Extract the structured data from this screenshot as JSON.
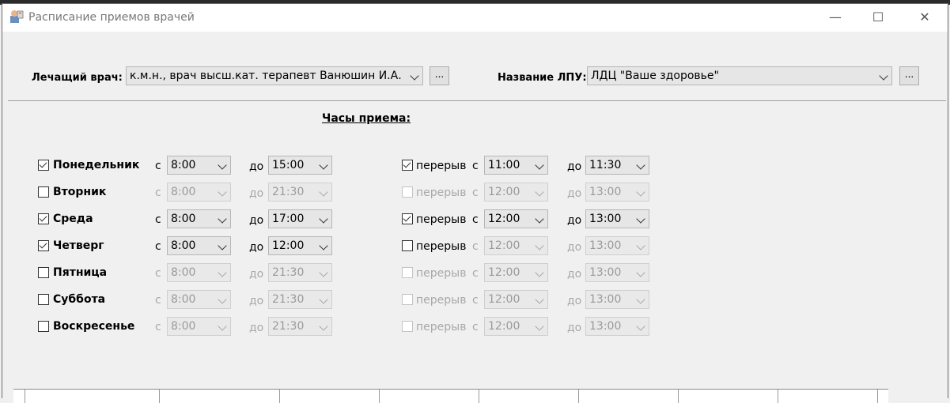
{
  "window": {
    "title": "Расписание приемов врачей",
    "min_icon": "minimize-icon",
    "max_icon": "maximize-icon",
    "close_icon": "close-icon"
  },
  "doctor": {
    "label": "Лечащий врач:",
    "value": "к.м.н., врач высш.кат. терапевт Ванюшин И.А.",
    "button": "..."
  },
  "lpu": {
    "label": "Название ЛПУ:",
    "value": "ЛДЦ \"Ваше здоровье\"",
    "button": "..."
  },
  "hours_title": "Часы приема:",
  "labels": {
    "from": "с",
    "to": "до",
    "break": "перерыв"
  },
  "days": [
    {
      "name": "Понедельник",
      "checked": true,
      "from": "8:00",
      "to": "15:00",
      "break_checked": true,
      "break_from": "11:00",
      "break_to": "11:30"
    },
    {
      "name": "Вторник",
      "checked": false,
      "from": "8:00",
      "to": "21:30",
      "break_checked": false,
      "break_from": "12:00",
      "break_to": "13:00"
    },
    {
      "name": "Среда",
      "checked": true,
      "from": "8:00",
      "to": "17:00",
      "break_checked": true,
      "break_from": "12:00",
      "break_to": "13:00"
    },
    {
      "name": "Четверг",
      "checked": true,
      "from": "8:00",
      "to": "12:00",
      "break_checked": false,
      "break_from": "12:00",
      "break_to": "13:00"
    },
    {
      "name": "Пятница",
      "checked": false,
      "from": "8:00",
      "to": "21:30",
      "break_checked": false,
      "break_from": "12:00",
      "break_to": "13:00"
    },
    {
      "name": "Суббота",
      "checked": false,
      "from": "8:00",
      "to": "21:30",
      "break_checked": false,
      "break_from": "12:00",
      "break_to": "13:00"
    },
    {
      "name": "Воскресенье",
      "checked": false,
      "from": "8:00",
      "to": "21:30",
      "break_checked": false,
      "break_from": "12:00",
      "break_to": "13:00"
    }
  ]
}
